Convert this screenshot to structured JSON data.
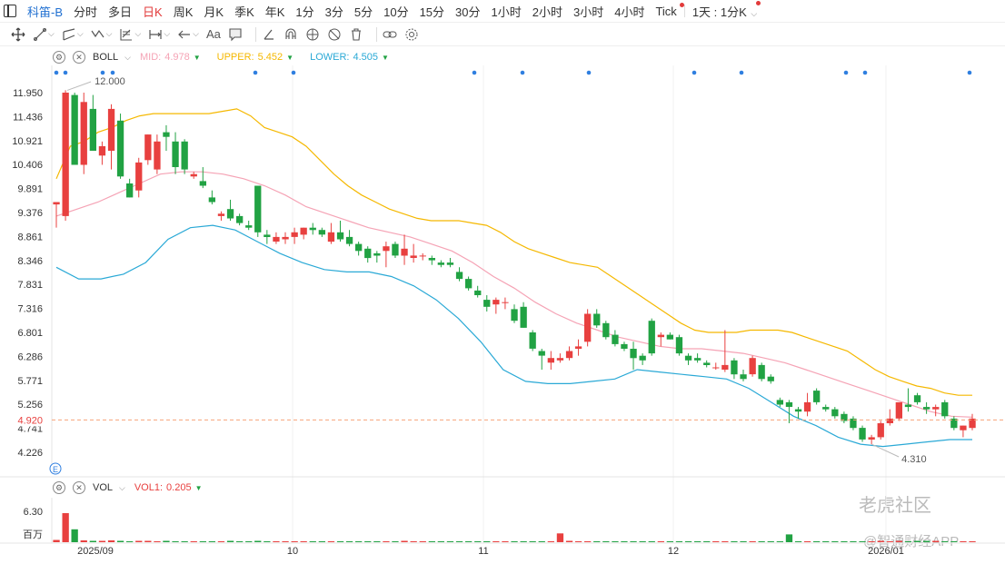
{
  "symbol": "科笛-B",
  "timeframes": [
    "分时",
    "多日",
    "日K",
    "周K",
    "月K",
    "季K",
    "年K",
    "1分",
    "3分",
    "5分",
    "10分",
    "15分",
    "30分",
    "1小时",
    "2小时",
    "3小时",
    "4小时",
    "Tick",
    "1天 : 1分K"
  ],
  "active_timeframe": "日K",
  "toolbar_text_tool": "Aa",
  "boll": {
    "name": "BOLL",
    "mid_label": "MID:",
    "mid": "4.978",
    "upper_label": "UPPER:",
    "upper": "5.452",
    "lower_label": "LOWER:",
    "lower": "4.505",
    "mid_color": "#f5a3b5",
    "upper_color": "#f5b800",
    "lower_color": "#2aa9d6"
  },
  "vol": {
    "name": "VOL",
    "vol1_label": "VOL1:",
    "vol1": "0.205",
    "ytick": "6.30",
    "unit": "百万"
  },
  "current_price": "4.920",
  "high_annotation": "12.000",
  "low_annotation": "4.310",
  "event_marker": "E",
  "watermark_1": "老虎社区",
  "watermark_2": "@智通财经APP",
  "colors": {
    "up": "#e8403f",
    "down": "#21a243",
    "price_line": "#f6a37a",
    "marker": "#2f7fe0"
  },
  "chart_data": {
    "type": "candlestick",
    "y_ticks": [
      "11.950",
      "11.436",
      "10.921",
      "10.406",
      "9.891",
      "9.376",
      "8.861",
      "8.346",
      "7.831",
      "7.316",
      "6.801",
      "6.286",
      "5.771",
      "5.256",
      "4.741",
      "4.226"
    ],
    "x_ticks": [
      "2025/09",
      "10",
      "11",
      "12",
      "2026/01"
    ],
    "ylim": [
      4.0,
      12.1
    ],
    "candles": [
      [
        9.55,
        9.6,
        9.05,
        9.6
      ],
      [
        9.3,
        12.0,
        9.2,
        11.95
      ],
      [
        11.9,
        11.95,
        10.4,
        10.4
      ],
      [
        10.4,
        11.95,
        10.2,
        11.75
      ],
      [
        11.6,
        11.9,
        10.9,
        10.7
      ],
      [
        10.6,
        10.9,
        10.4,
        10.8
      ],
      [
        10.7,
        11.7,
        10.3,
        11.6
      ],
      [
        11.35,
        11.5,
        10.1,
        10.15
      ],
      [
        10.0,
        10.1,
        9.7,
        9.7
      ],
      [
        9.85,
        10.55,
        9.7,
        10.45
      ],
      [
        10.5,
        11.05,
        10.4,
        11.05
      ],
      [
        10.3,
        11.05,
        10.2,
        10.9
      ],
      [
        11.1,
        11.25,
        10.7,
        11.0
      ],
      [
        10.9,
        11.1,
        10.2,
        10.35
      ],
      [
        10.9,
        10.95,
        10.2,
        10.3
      ],
      [
        10.15,
        10.25,
        10.1,
        10.2
      ],
      [
        10.05,
        10.35,
        9.9,
        9.95
      ],
      [
        9.7,
        9.85,
        9.55,
        9.6
      ],
      [
        9.3,
        9.4,
        9.2,
        9.35
      ],
      [
        9.45,
        9.65,
        9.2,
        9.25
      ],
      [
        9.3,
        9.35,
        9.1,
        9.15
      ],
      [
        9.1,
        9.2,
        9.0,
        9.05
      ],
      [
        9.95,
        9.95,
        8.85,
        8.95
      ],
      [
        8.9,
        9.0,
        8.7,
        8.85
      ],
      [
        8.75,
        8.95,
        8.7,
        8.85
      ],
      [
        8.8,
        8.95,
        8.7,
        8.85
      ],
      [
        8.85,
        9.05,
        8.7,
        8.95
      ],
      [
        8.9,
        9.05,
        8.8,
        9.05
      ],
      [
        9.05,
        9.15,
        8.9,
        9.0
      ],
      [
        9.0,
        9.05,
        8.85,
        8.9
      ],
      [
        8.75,
        9.15,
        8.7,
        8.95
      ],
      [
        8.95,
        9.2,
        8.75,
        8.8
      ],
      [
        8.85,
        9.0,
        8.65,
        8.7
      ],
      [
        8.7,
        8.75,
        8.45,
        8.55
      ],
      [
        8.6,
        8.65,
        8.3,
        8.4
      ],
      [
        8.5,
        8.55,
        8.3,
        8.45
      ],
      [
        8.55,
        8.75,
        8.2,
        8.65
      ],
      [
        8.7,
        8.75,
        8.4,
        8.45
      ],
      [
        8.45,
        8.9,
        8.25,
        8.6
      ],
      [
        8.4,
        8.7,
        8.3,
        8.45
      ],
      [
        8.45,
        8.5,
        8.35,
        8.45
      ],
      [
        8.4,
        8.45,
        8.25,
        8.35
      ],
      [
        8.3,
        8.35,
        8.2,
        8.25
      ],
      [
        8.3,
        8.4,
        8.2,
        8.25
      ],
      [
        8.1,
        8.2,
        7.9,
        7.95
      ],
      [
        7.95,
        8.0,
        7.7,
        7.75
      ],
      [
        7.7,
        7.8,
        7.55,
        7.6
      ],
      [
        7.5,
        7.6,
        7.25,
        7.35
      ],
      [
        7.4,
        7.55,
        7.2,
        7.5
      ],
      [
        7.45,
        7.55,
        7.3,
        7.45
      ],
      [
        7.3,
        7.4,
        7.0,
        7.05
      ],
      [
        7.35,
        7.45,
        6.9,
        6.9
      ],
      [
        6.8,
        6.85,
        6.4,
        6.45
      ],
      [
        6.4,
        6.45,
        6.0,
        6.3
      ],
      [
        6.15,
        6.4,
        6.0,
        6.25
      ],
      [
        6.2,
        6.35,
        6.15,
        6.25
      ],
      [
        6.25,
        6.5,
        6.2,
        6.4
      ],
      [
        6.45,
        6.65,
        6.3,
        6.5
      ],
      [
        6.6,
        7.3,
        6.5,
        7.2
      ],
      [
        7.2,
        7.3,
        6.9,
        6.95
      ],
      [
        7.0,
        7.05,
        6.65,
        6.7
      ],
      [
        6.75,
        6.85,
        6.5,
        6.55
      ],
      [
        6.55,
        6.6,
        6.4,
        6.45
      ],
      [
        6.45,
        6.6,
        6.0,
        6.25
      ],
      [
        6.3,
        6.35,
        6.1,
        6.2
      ],
      [
        7.05,
        7.1,
        6.3,
        6.35
      ],
      [
        6.7,
        6.8,
        6.5,
        6.75
      ],
      [
        6.75,
        6.8,
        6.65,
        6.65
      ],
      [
        6.7,
        6.75,
        6.3,
        6.35
      ],
      [
        6.3,
        6.35,
        6.1,
        6.2
      ],
      [
        6.25,
        6.35,
        6.15,
        6.2
      ],
      [
        6.15,
        6.2,
        6.05,
        6.1
      ],
      [
        6.05,
        6.15,
        6.0,
        6.05
      ],
      [
        6.0,
        6.85,
        5.95,
        6.1
      ],
      [
        6.2,
        6.25,
        5.8,
        5.9
      ],
      [
        5.9,
        6.0,
        5.75,
        5.8
      ],
      [
        5.9,
        6.3,
        5.85,
        6.25
      ],
      [
        6.1,
        6.15,
        5.75,
        5.8
      ],
      [
        5.85,
        5.9,
        5.7,
        5.75
      ],
      [
        5.35,
        5.4,
        5.2,
        5.25
      ],
      [
        5.3,
        5.35,
        4.85,
        5.2
      ],
      [
        5.15,
        5.2,
        4.95,
        5.1
      ],
      [
        5.1,
        5.5,
        5.0,
        5.3
      ],
      [
        5.55,
        5.6,
        5.25,
        5.3
      ],
      [
        5.2,
        5.25,
        5.1,
        5.15
      ],
      [
        5.15,
        5.2,
        4.95,
        5.0
      ],
      [
        5.05,
        5.1,
        4.85,
        4.9
      ],
      [
        4.95,
        5.0,
        4.7,
        4.75
      ],
      [
        4.75,
        4.8,
        4.45,
        4.5
      ],
      [
        4.5,
        4.6,
        4.4,
        4.55
      ],
      [
        4.55,
        4.9,
        4.5,
        4.85
      ],
      [
        4.85,
        5.15,
        4.8,
        4.95
      ],
      [
        4.95,
        5.25,
        4.9,
        5.3
      ],
      [
        5.25,
        5.6,
        5.1,
        5.2
      ],
      [
        5.45,
        5.5,
        5.25,
        5.3
      ],
      [
        5.2,
        5.3,
        5.05,
        5.15
      ],
      [
        5.15,
        5.25,
        5.0,
        5.2
      ],
      [
        5.3,
        5.35,
        4.95,
        5.0
      ],
      [
        4.95,
        5.0,
        4.7,
        4.75
      ],
      [
        4.7,
        4.8,
        4.55,
        4.8
      ],
      [
        4.75,
        5.05,
        4.7,
        4.95
      ]
    ],
    "volume_ylim": [
      0,
      7
    ],
    "volumes": [
      0.5,
      6.3,
      2.8,
      0.4,
      0.3,
      0.3,
      0.4,
      0.3,
      0.2,
      0.3,
      0.3,
      0.2,
      0.3,
      0.2,
      0.2,
      0.2,
      0.2,
      0.2,
      0.2,
      0.3,
      0.2,
      0.2,
      0.3,
      0.2,
      0.2,
      0.2,
      0.2,
      0.2,
      0.2,
      0.2,
      0.2,
      0.2,
      0.2,
      0.2,
      0.2,
      0.2,
      0.2,
      0.2,
      0.3,
      0.2,
      0.2,
      0.2,
      0.2,
      0.2,
      0.2,
      0.2,
      0.2,
      0.2,
      0.2,
      0.2,
      0.2,
      0.2,
      0.2,
      0.2,
      0.2,
      1.9,
      0.3,
      0.2,
      0.2,
      0.2,
      0.2,
      0.2,
      0.2,
      0.2,
      0.2,
      0.2,
      0.2,
      0.2,
      0.2,
      0.2,
      0.2,
      0.2,
      0.2,
      0.2,
      0.2,
      0.2,
      0.2,
      0.2,
      0.2,
      0.2,
      1.7,
      0.2,
      0.2,
      0.2,
      0.2,
      0.2,
      0.2,
      0.2,
      0.2,
      0.2,
      0.3,
      0.2,
      0.3,
      0.2,
      0.3,
      0.3,
      0.3,
      0.2,
      0.2,
      0.2,
      0.2
    ],
    "upper_band": [
      10.1,
      10.8,
      10.9,
      11.1,
      11.2,
      11.35,
      11.45,
      11.5,
      11.5,
      11.5,
      11.5,
      11.5,
      11.55,
      11.6,
      11.45,
      11.2,
      11.1,
      11.0,
      10.8,
      10.5,
      10.2,
      9.95,
      9.75,
      9.6,
      9.45,
      9.35,
      9.25,
      9.2,
      9.2,
      9.2,
      9.15,
      9.1,
      8.95,
      8.75,
      8.6,
      8.5,
      8.4,
      8.3,
      8.25,
      8.2,
      8.0,
      7.8,
      7.6,
      7.4,
      7.2,
      7.0,
      6.85,
      6.8,
      6.8,
      6.8,
      6.85,
      6.85,
      6.85,
      6.8,
      6.7,
      6.6,
      6.5,
      6.4,
      6.2,
      6.0,
      5.85,
      5.75,
      5.65,
      5.6,
      5.5,
      5.45,
      5.45
    ],
    "upper_x": [
      0,
      1,
      2,
      3,
      4,
      5,
      6,
      7,
      8,
      9,
      10,
      11,
      12,
      13,
      14,
      15,
      16,
      17,
      18,
      19,
      20,
      21,
      22,
      23,
      24,
      25,
      26,
      27,
      28,
      29,
      30,
      31,
      32,
      33,
      34,
      35,
      36,
      37,
      38,
      39,
      40,
      41,
      42,
      43,
      44,
      45,
      46,
      47,
      48,
      49,
      50,
      51,
      52,
      53,
      54,
      55,
      56,
      57,
      58,
      59,
      60,
      61,
      62,
      63,
      64,
      65,
      66
    ],
    "mid_band": [
      9.3,
      9.45,
      9.6,
      9.8,
      10.0,
      10.2,
      10.25,
      10.25,
      10.2,
      10.1,
      9.95,
      9.75,
      9.5,
      9.35,
      9.2,
      9.05,
      8.95,
      8.85,
      8.7,
      8.55,
      8.3,
      8.0,
      7.75,
      7.45,
      7.2,
      7.0,
      6.85,
      6.7,
      6.6,
      6.5,
      6.45,
      6.45,
      6.4,
      6.35,
      6.25,
      6.15,
      6.0,
      5.85,
      5.7,
      5.55,
      5.4,
      5.25,
      5.1,
      5.0,
      4.98
    ],
    "lower_band": [
      8.2,
      7.95,
      7.95,
      8.05,
      8.3,
      8.8,
      9.05,
      9.1,
      9.0,
      8.75,
      8.5,
      8.3,
      8.15,
      8.1,
      8.1,
      8.0,
      7.8,
      7.5,
      7.1,
      6.6,
      6.0,
      5.75,
      5.7,
      5.7,
      5.75,
      5.8,
      6.0,
      5.95,
      5.9,
      5.85,
      5.8,
      5.6,
      5.3,
      5.0,
      4.8,
      4.55,
      4.4,
      4.35,
      4.4,
      4.45,
      4.5,
      4.5
    ]
  }
}
